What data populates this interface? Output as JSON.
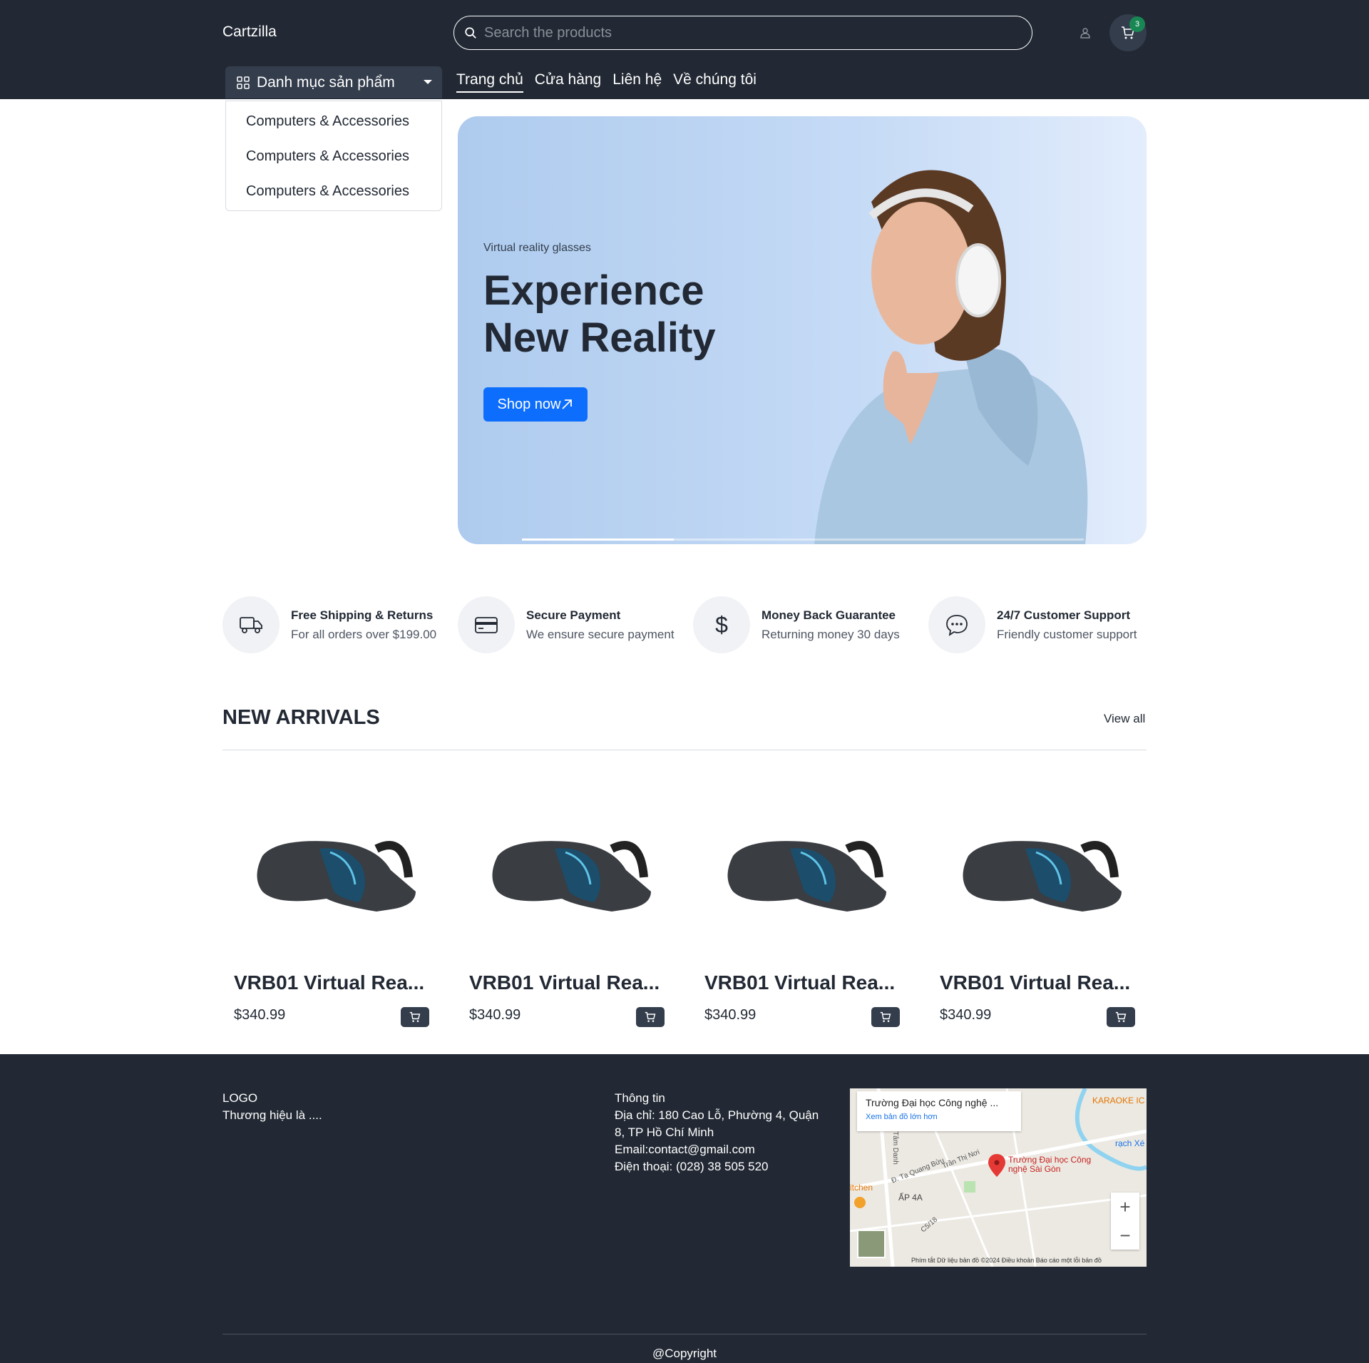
{
  "header": {
    "logo": "Cartzilla",
    "search_placeholder": "Search the products",
    "cart_count": "3",
    "category_button": "Danh mục sản phẩm",
    "nav": [
      {
        "label": "Trang chủ",
        "active": true
      },
      {
        "label": "Cửa hàng"
      },
      {
        "label": "Liên hệ"
      },
      {
        "label": "Về chúng tôi"
      }
    ],
    "categories": [
      "Computers & Accessories",
      "Computers & Accessories",
      "Computers & Accessories"
    ]
  },
  "hero": {
    "eyebrow": "Virtual reality glasses",
    "title": "Experience New Reality",
    "button": "Shop now",
    "slide_progress": 0.27
  },
  "features": [
    {
      "icon": "truck-icon",
      "title": "Free Shipping & Returns",
      "subtitle": "For all orders over $199.00"
    },
    {
      "icon": "credit-card-icon",
      "title": "Secure Payment",
      "subtitle": "We ensure secure payment"
    },
    {
      "icon": "dollar-icon",
      "title": "Money Back Guarantee",
      "subtitle": "Returning money 30 days"
    },
    {
      "icon": "chat-icon",
      "title": "24/7 Customer Support",
      "subtitle": "Friendly customer support"
    }
  ],
  "new_arrivals": {
    "title": "NEW ARRIVALS",
    "view_all": "View all",
    "products": [
      {
        "name": "VRB01 Virtual Rea...",
        "price": "$340.99"
      },
      {
        "name": "VRB01 Virtual Rea...",
        "price": "$340.99"
      },
      {
        "name": "VRB01 Virtual Rea...",
        "price": "$340.99"
      },
      {
        "name": "VRB01 Virtual Rea...",
        "price": "$340.99"
      }
    ]
  },
  "footer": {
    "logo": "LOGO",
    "tagline": "Thương hiệu là ....",
    "info_title": "Thông tin",
    "address": "Địa chỉ: 180 Cao Lỗ, Phường 4, Quận 8, TP Hồ Chí Minh",
    "email": "Email:contact@gmail.com",
    "phone": "Điện thoại: (028) 38 505 520",
    "map": {
      "place": "Trường Đại học Công nghệ ...",
      "link": "Xem bản đồ lớn hơn",
      "pin_label": "Trường Đại học Công nghệ Sài Gòn",
      "labels": [
        "KARAOKE IC",
        "rạch Xé",
        "Tâm Danh",
        "Đ. Tạ Quang Bửu",
        "Trần Thị Nơi",
        "ẤP 4A",
        "C5/18",
        "itchen"
      ],
      "attribution": "Phím tắt   Dữ liệu bản đồ ©2024   Điều khoản   Báo cáo một lỗi bản đồ"
    },
    "copyright": "@Copyright"
  },
  "colors": {
    "dark": "#222934",
    "dark_secondary": "#333d4c",
    "primary": "#0d6efd",
    "success": "#198754"
  }
}
